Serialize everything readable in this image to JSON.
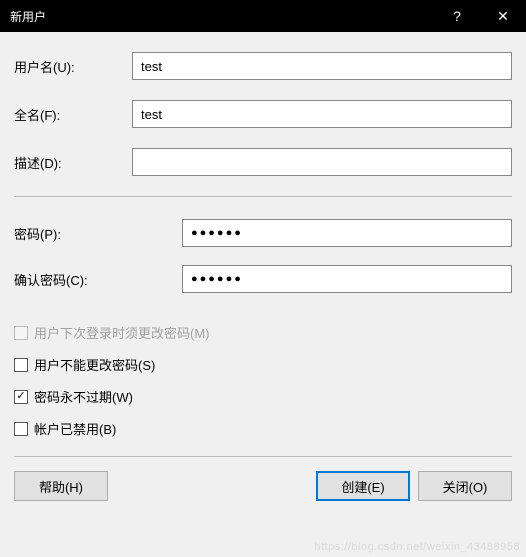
{
  "titlebar": {
    "title": "新用户",
    "help_icon": "?",
    "close_icon": "✕"
  },
  "fields": {
    "username_label": "用户名(U):",
    "username_value": "test",
    "fullname_label": "全名(F):",
    "fullname_value": "test",
    "description_label": "描述(D):",
    "description_value": "",
    "password_label": "密码(P):",
    "password_mask": "●●●●●●",
    "confirm_label": "确认密码(C):",
    "confirm_mask": "●●●●●●"
  },
  "checkboxes": {
    "must_change": {
      "label": "用户下次登录时须更改密码(M)",
      "checked": false,
      "enabled": false
    },
    "cannot_change": {
      "label": "用户不能更改密码(S)",
      "checked": false,
      "enabled": true
    },
    "never_expires": {
      "label": "密码永不过期(W)",
      "checked": true,
      "enabled": true
    },
    "disabled_acct": {
      "label": "帐户已禁用(B)",
      "checked": false,
      "enabled": true
    }
  },
  "buttons": {
    "help": "帮助(H)",
    "create": "创建(E)",
    "close": "关闭(O)"
  },
  "watermark": "https://blog.csdn.net/weixin_43488958"
}
